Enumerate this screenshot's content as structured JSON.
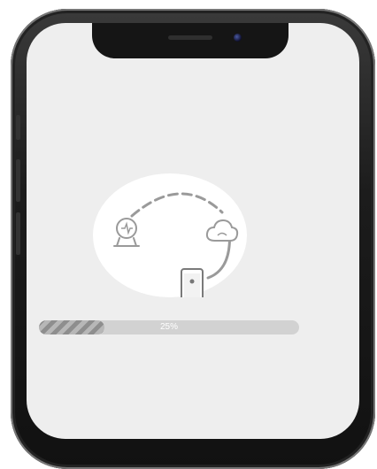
{
  "status_bar": {
    "carrier": "",
    "time": ""
  },
  "setup": {
    "progress": {
      "value": 0.25,
      "label": "25%"
    },
    "hint_text": ""
  },
  "icons": [
    "front-camera-icon",
    "speaker-grille-icon",
    "device-icon",
    "cloud-icon",
    "smartphone-icon",
    "connection-arc-icon"
  ],
  "colors": {
    "screen_background": "#eeeeee",
    "progress_track": "#d2d2d2",
    "progress_fill": "#8e8e8e",
    "illustration_stroke": "#9a9a9a",
    "phone_frame": "#1c1c1c"
  }
}
